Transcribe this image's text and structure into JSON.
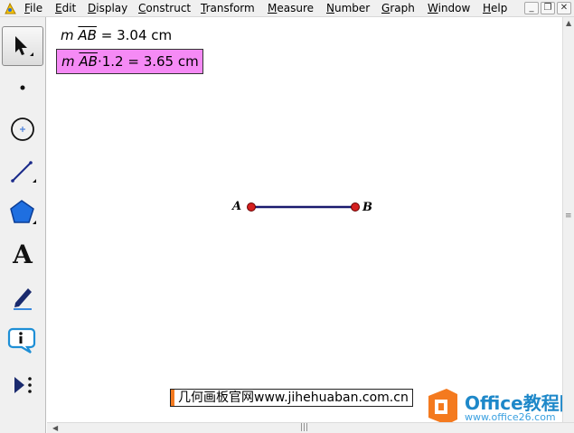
{
  "menu": {
    "items": [
      "File",
      "Edit",
      "Display",
      "Construct",
      "Transform",
      "Measure",
      "Number",
      "Graph",
      "Window",
      "Help"
    ]
  },
  "window_controls": {
    "minimize": "_",
    "restore": "❐",
    "close": "✕"
  },
  "toolbox": {
    "tools": [
      "select-arrow",
      "point",
      "compass",
      "straightedge",
      "polygon",
      "text",
      "marker",
      "information",
      "custom-tools"
    ],
    "text_tool_glyph": "A",
    "info_tool_glyph": "i"
  },
  "canvas": {
    "measure1": {
      "prefix": "m",
      "segment": "AB",
      "value": "= 3.04 cm"
    },
    "measure2": {
      "prefix": "m",
      "segment": "AB",
      "value": "·1.2 = 3.65 cm",
      "highlight": "#f58af5"
    },
    "segment": {
      "color": "#1a1a6e",
      "point_color": "#d42020",
      "label_a": "A",
      "label_b": "B"
    },
    "watermark": "几何画板官网www.jihehuaban.com.cn"
  },
  "logo": {
    "name": "Office教程网",
    "url": "www.office26.com",
    "accent": "#f47a1f"
  }
}
